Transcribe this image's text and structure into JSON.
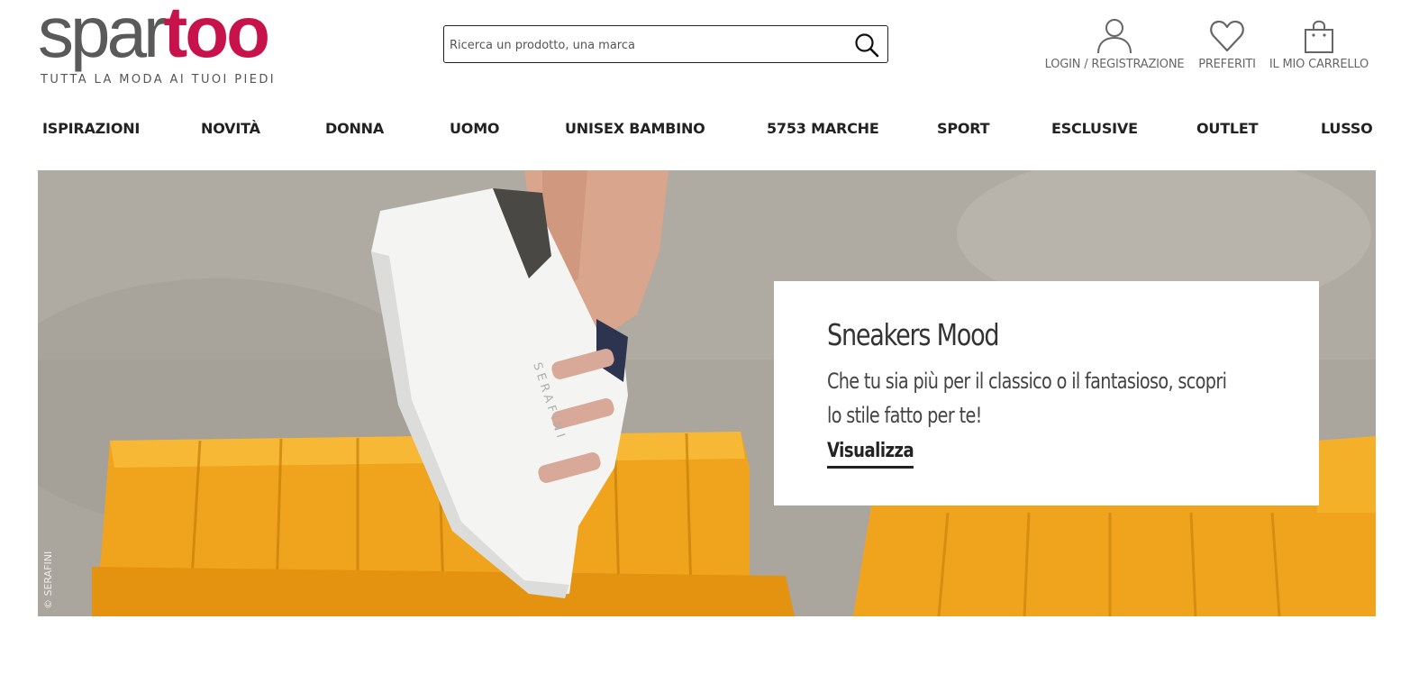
{
  "brand": {
    "logo_part1": "spar",
    "logo_part2": "too",
    "tagline": "TUTTA LA MODA AI TUOI PIEDI",
    "primary_color": "#c8124b",
    "text_color": "#5a5a5a"
  },
  "search": {
    "placeholder": "Ricerca un prodotto, una marca",
    "value": "",
    "icon": "search-icon"
  },
  "header_actions": [
    {
      "label": "LOGIN / REGISTRAZIONE",
      "icon": "user-icon"
    },
    {
      "label": "PREFERITI",
      "icon": "heart-icon"
    },
    {
      "label": "IL MIO CARRELLO",
      "icon": "shopping-bag-icon"
    }
  ],
  "nav": {
    "items": [
      {
        "label": "ISPIRAZIONI"
      },
      {
        "label": "NOVITÀ"
      },
      {
        "label": "DONNA"
      },
      {
        "label": "UOMO"
      },
      {
        "label": "UNISEX BAMBINO"
      },
      {
        "label": "5753 MARCHE"
      },
      {
        "label": "SPORT"
      },
      {
        "label": "ESCLUSIVE"
      },
      {
        "label": "OUTLET"
      },
      {
        "label": "LUSSO"
      }
    ]
  },
  "hero": {
    "credit": "© SERAFINI",
    "shoe_brand_text": "SERAFINI",
    "promo": {
      "title": "Sneakers Mood",
      "text": "Che tu sia più per il classico o il fantasioso, scopri lo stile fatto per te!",
      "cta": "Visualizza"
    }
  }
}
